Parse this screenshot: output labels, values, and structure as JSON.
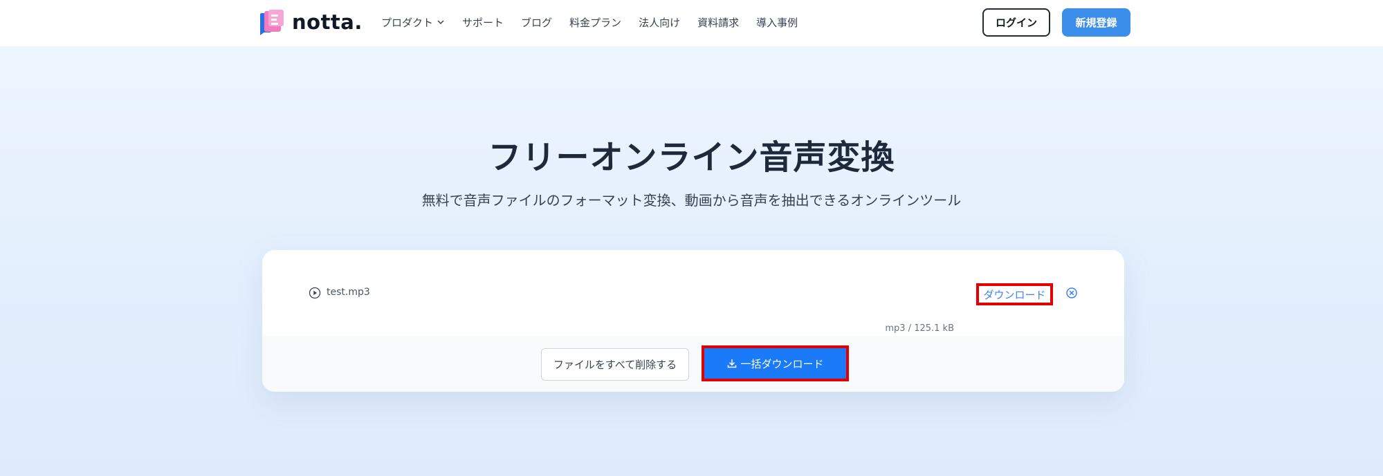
{
  "header": {
    "logo_text": "notta.",
    "nav": [
      {
        "label": "プロダクト",
        "has_dropdown": true
      },
      {
        "label": "サポート"
      },
      {
        "label": "ブログ"
      },
      {
        "label": "料金プラン"
      },
      {
        "label": "法人向け"
      },
      {
        "label": "資料請求"
      },
      {
        "label": "導入事例"
      }
    ],
    "login_label": "ログイン",
    "signup_label": "新規登録"
  },
  "hero": {
    "title": "フリーオンライン音声変換",
    "subtitle": "無料で音声ファイルのフォーマット変換、動画から音声を抽出できるオンラインツール"
  },
  "converter": {
    "file": {
      "name": "test.mp3",
      "meta": "mp3 / 125.1 kB",
      "download_label": "ダウンロード"
    },
    "delete_all_label": "ファイルをすべて削除する",
    "bulk_download_label": "一括ダウンロード"
  },
  "colors": {
    "accent": "#3b8eea",
    "primary_button": "#1a7af8",
    "highlight_border": "#e30000",
    "title": "#1e293b"
  },
  "icons": {
    "nav_dropdown": "chevron-down-icon",
    "file_play": "play-circle-icon",
    "file_remove": "close-circle-icon",
    "bulk_download": "download-icon"
  }
}
